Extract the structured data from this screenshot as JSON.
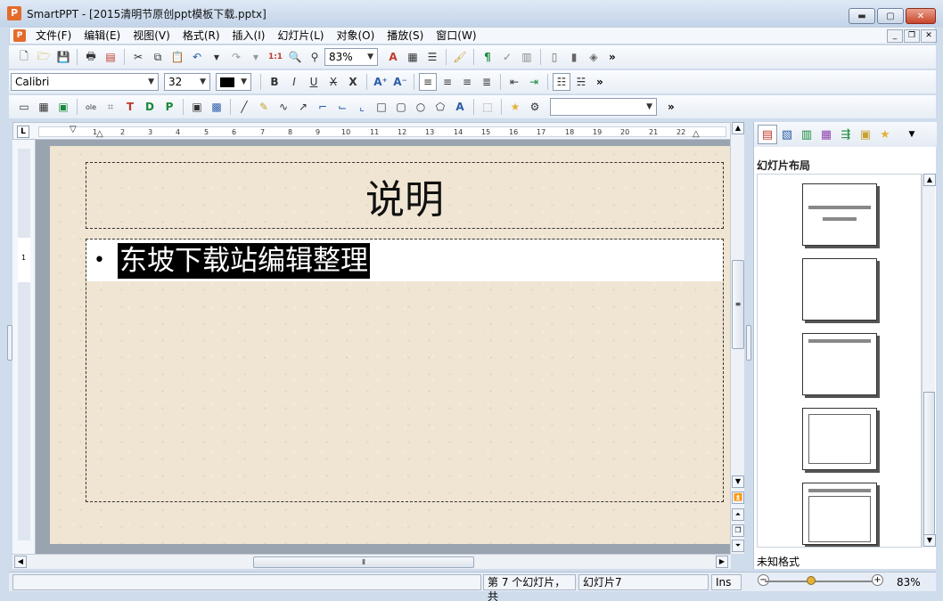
{
  "window": {
    "app_name": "SmartPPT",
    "title": "SmartPPT - [2015清明节原创ppt模板下载.pptx]",
    "logo_glyph": "P",
    "minimize_glyph": "▬",
    "maximize_glyph": "▢",
    "close_glyph": "✕"
  },
  "menu": {
    "items": [
      "文件(F)",
      "编辑(E)",
      "视图(V)",
      "格式(R)",
      "插入(I)",
      "幻灯片(L)",
      "对象(O)",
      "播放(S)",
      "窗口(W)"
    ],
    "mdi_min": "_",
    "mdi_restore": "❐",
    "mdi_close": "✕"
  },
  "toolbar1": {
    "zoom_value": "83%",
    "more": "»"
  },
  "toolbar2": {
    "font_name": "Calibri",
    "font_size": "32",
    "more": "»"
  },
  "toolbar3": {
    "style_value": "",
    "more": "»"
  },
  "ruler": {
    "corner": "L",
    "ticks": [
      "1",
      "2",
      "3",
      "4",
      "5",
      "6",
      "7",
      "8",
      "9",
      "10",
      "11",
      "12",
      "13",
      "14",
      "15",
      "16",
      "17",
      "18",
      "19",
      "20",
      "21",
      "22"
    ],
    "vertical_mark": "1"
  },
  "slide": {
    "title": "说明",
    "bullet": "•",
    "body_text": "东坡下载站编辑整理"
  },
  "task_pane": {
    "title": "幻灯片布局",
    "footer_label": "未知格式"
  },
  "status": {
    "slide_info": "第 7 个幻灯片，共",
    "slide_name": "幻灯片7",
    "mode": "Ins",
    "zoom": "83%"
  },
  "colors": {
    "accent": "#e36c2c",
    "slide_bg": "#efe5d2",
    "selection": "#000000"
  }
}
